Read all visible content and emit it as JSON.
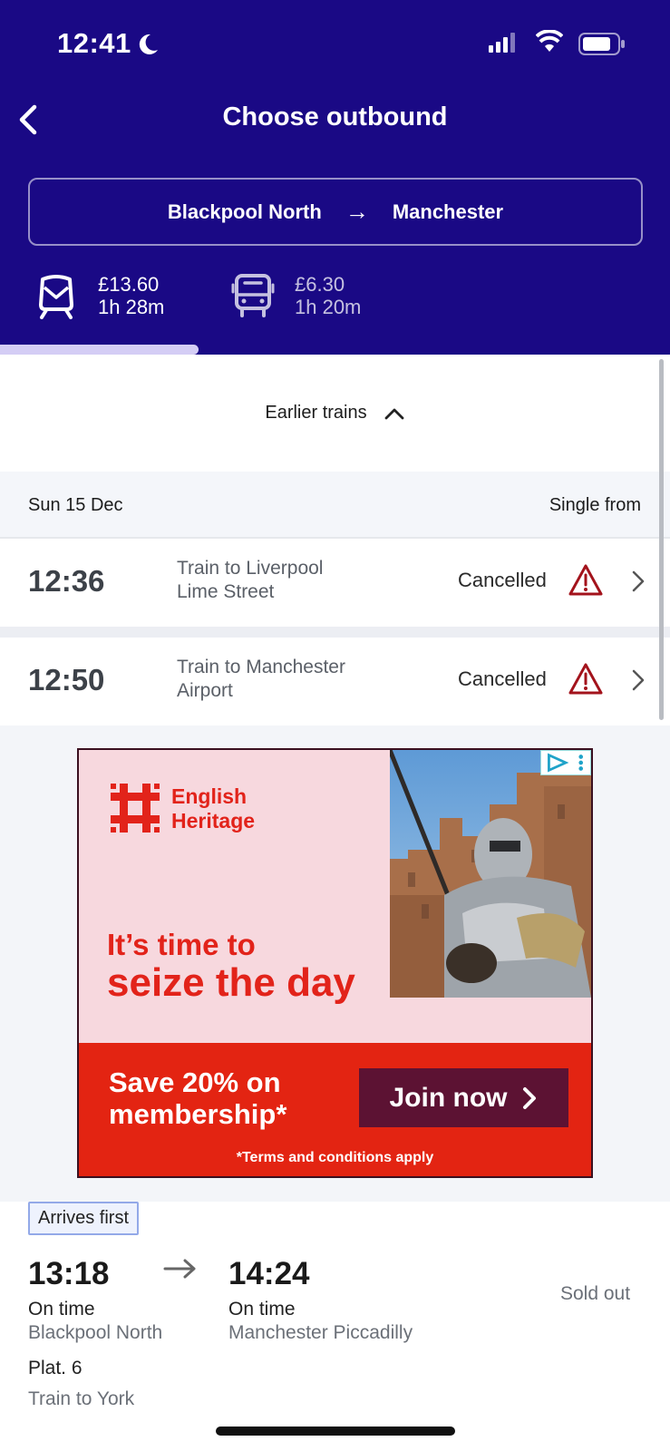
{
  "status_bar": {
    "time": "12:41"
  },
  "header": {
    "title": "Choose outbound",
    "route": {
      "origin": "Blackpool North",
      "arrow": "→",
      "destination": "Manchester"
    },
    "modes": [
      {
        "icon": "train-icon",
        "price": "£13.60",
        "duration": "1h 28m",
        "selected": true
      },
      {
        "icon": "bus-icon",
        "price": "£6.30",
        "duration": "1h 20m",
        "selected": false
      }
    ]
  },
  "earlier": {
    "label": "Earlier trains"
  },
  "date_band": {
    "date": "Sun 15 Dec",
    "single_label": "Single from"
  },
  "trains": [
    {
      "time": "12:36",
      "line1": "Train to Liverpool",
      "line2": "Lime Street",
      "status": "Cancelled"
    },
    {
      "time": "12:50",
      "line1": "Train to Manchester",
      "line2": "Airport",
      "status": "Cancelled"
    }
  ],
  "ad": {
    "brand_line1": "English",
    "brand_line2": "Heritage",
    "headline1": "It’s time to",
    "headline2": "seize the day",
    "offer_line1": "Save 20% on",
    "offer_line2": "membership*",
    "cta": "Join now",
    "terms": "*Terms and conditions apply",
    "colors": {
      "brand_red": "#e2231a",
      "cta_bg": "#5c1233",
      "bg_pink": "#f7d8de"
    }
  },
  "journey": {
    "badge": "Arrives first",
    "depart_time": "13:18",
    "arrive_time": "14:24",
    "depart_status": "On time",
    "arrive_status": "On time",
    "from_station": "Blackpool North",
    "to_station": "Manchester Piccadilly",
    "platform": "Plat. 6",
    "service": "Train to York",
    "availability": "Sold out"
  },
  "colors": {
    "header_bg": "#1a0985",
    "tab_indicator": "#d4cdf5",
    "warning": "#a3131c"
  }
}
